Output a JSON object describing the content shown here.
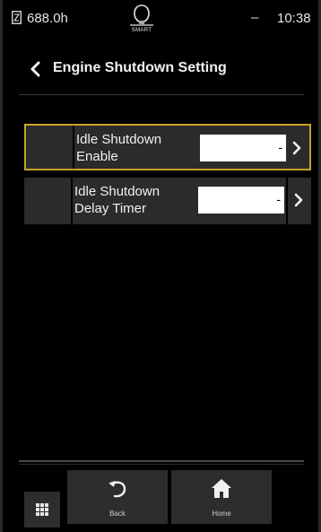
{
  "status_bar": {
    "hours": "688.0h",
    "smart_label": "SMART",
    "indicator": "–",
    "clock": "10:38"
  },
  "header": {
    "title": "Engine Shutdown Setting"
  },
  "settings": [
    {
      "label": "Idle Shutdown Enable",
      "value": "-",
      "selected": true
    },
    {
      "label": "Idle Shutdown Delay Timer",
      "value": "-",
      "selected": false
    }
  ],
  "bottom_nav": {
    "back_label": "Back",
    "home_label": "Home"
  },
  "colors": {
    "background": "#000000",
    "row": "#2b2b2b",
    "selection": "#c9a227",
    "value_box": "#ffffff"
  }
}
